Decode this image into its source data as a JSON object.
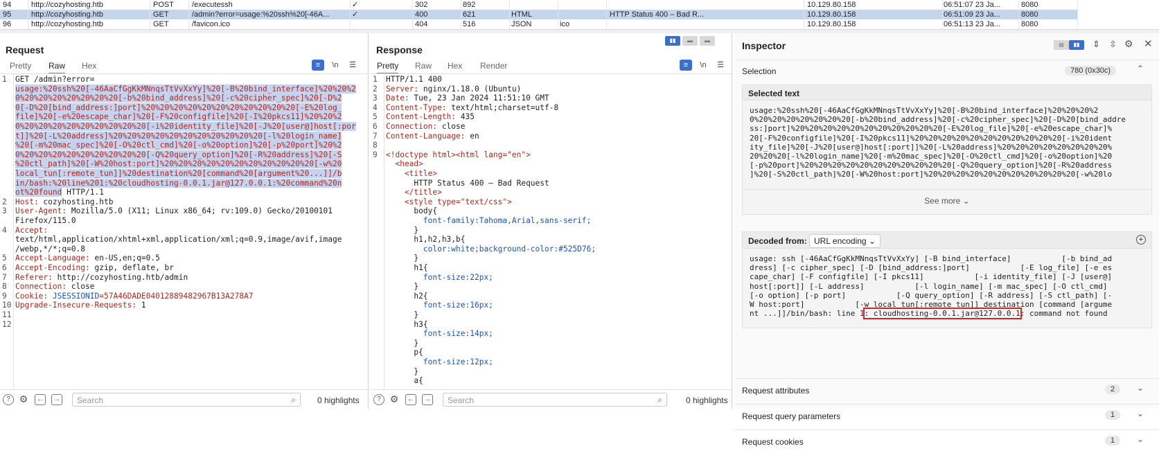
{
  "history": {
    "rows": [
      {
        "num": "94",
        "host": "http://cozyhosting.htb",
        "method": "POST",
        "url": "/executessh",
        "edited": "",
        "params": "✓",
        "status": "302",
        "length": "892",
        "mime": "",
        "ext": "",
        "title": "",
        "ip": "10.129.80.158",
        "time": "06:51:07 23 Ja...",
        "port": "8080"
      },
      {
        "num": "95",
        "host": "http://cozyhosting.htb",
        "method": "GET",
        "url": "/admin?error=usage:%20ssh%20[-46A...",
        "edited": "",
        "params": "✓",
        "status": "400",
        "length": "621",
        "mime": "HTML",
        "ext": "",
        "title": "HTTP Status 400 – Bad R...",
        "ip": "10.129.80.158",
        "time": "06:51:09 23 Ja...",
        "port": "8080"
      },
      {
        "num": "96",
        "host": "http://cozyhosting.htb",
        "method": "GET",
        "url": "/favicon.ico",
        "edited": "",
        "params": "",
        "status": "404",
        "length": "516",
        "mime": "JSON",
        "ext": "ico",
        "title": "",
        "ip": "10.129.80.158",
        "time": "06:51:13 23 Ja...",
        "port": "8080"
      }
    ]
  },
  "request": {
    "title": "Request",
    "tabs": [
      "Pretty",
      "Raw",
      "Hex"
    ],
    "active_tab": "Raw",
    "line1_prefix": "GET /admin?error=",
    "hl_lines": [
      "usage:%20ssh%20[-46AaCfGgKkMNnqsTtVvXxYy]%20[-B%20bind_interface]%20%20%2",
      "0%20%20%20%20%20%20%20[-b%20bind_address]%20[-c%20cipher_spec]%20[-D%2",
      "0[-D%20[bind_address:]port]%20%20%20%20%20%20%20%20%20%20%20[-E%20log_",
      "file]%20[-e%20escape_char]%20[-F%20configfile]%20[-I%20pkcs11]%20%20%2",
      "0%20%20%20%20%20%20%20%20%20[-i%20identity_file]%20[-J%20[user@]host[:por",
      "t]]%20[-L%20address]%20%20%20%20%20%20%20%20%20%20%20[-l%20login_name]",
      "%20[-m%20mac_spec]%20[-O%20ctl_cmd]%20[-o%20option]%20[-p%20port]%20%2",
      "0%20%20%20%20%20%20%20%20%20[-Q%20query_option]%20[-R%20address]%20[-S",
      "%20ctl_path]%20[-W%20host:port]%20%20%20%20%20%20%20%20%20%20%20[-w%20",
      "local_tun[:remote_tun]]%20destination%20[command%20[argument%20...]]/b",
      "in/bash:%20line%201:%20cloudhosting-0.0.1.jar@127.0.0.1:%20command%20n",
      "ot%20found"
    ],
    "line1_suffix": " HTTP/1.1",
    "headers": [
      {
        "n": "2",
        "k": "Host:",
        "v": " cozyhosting.htb"
      },
      {
        "n": "3",
        "k": "User-Agent:",
        "v": " Mozilla/5.0 (X11; Linux x86_64; rv:109.0) Gecko/20100101"
      },
      {
        "n": "",
        "k": "",
        "v": "Firefox/115.0"
      },
      {
        "n": "4",
        "k": "Accept:",
        "v": ""
      },
      {
        "n": "",
        "k": "",
        "v": "text/html,application/xhtml+xml,application/xml;q=0.9,image/avif,image"
      },
      {
        "n": "",
        "k": "",
        "v": "/webp,*/*;q=0.8"
      },
      {
        "n": "5",
        "k": "Accept-Language:",
        "v": " en-US,en;q=0.5"
      },
      {
        "n": "6",
        "k": "Accept-Encoding:",
        "v": " gzip, deflate, br"
      },
      {
        "n": "7",
        "k": "Referer:",
        "v": " http://cozyhosting.htb/admin"
      },
      {
        "n": "8",
        "k": "Connection:",
        "v": " close"
      },
      {
        "n": "9",
        "k": "Cookie:",
        "v": " ",
        "ck": "JSESSIONID",
        "cv": "=57A46DADE04012889482967B13A278A7"
      },
      {
        "n": "10",
        "k": "Upgrade-Insecure-Requests:",
        "v": " 1"
      },
      {
        "n": "11",
        "k": "",
        "v": ""
      },
      {
        "n": "12",
        "k": "",
        "v": ""
      }
    ],
    "search_placeholder": "Search",
    "highlights": "0 highlights"
  },
  "response": {
    "title": "Response",
    "tabs": [
      "Pretty",
      "Raw",
      "Hex",
      "Render"
    ],
    "active_tab": "Pretty",
    "lines": [
      {
        "n": "1",
        "t": "HTTP/1.1 400",
        "kind": "plain"
      },
      {
        "n": "2",
        "k": "Server:",
        "v": " nginx/1.18.0 (Ubuntu)",
        "kind": "hdr"
      },
      {
        "n": "3",
        "k": "Date:",
        "v": " Tue, 23 Jan 2024 11:51:10 GMT",
        "kind": "hdr"
      },
      {
        "n": "4",
        "k": "Content-Type:",
        "v": " text/html;charset=utf-8",
        "kind": "hdr"
      },
      {
        "n": "5",
        "k": "Content-Length:",
        "v": " 435",
        "kind": "hdr"
      },
      {
        "n": "6",
        "k": "Connection:",
        "v": " close",
        "kind": "hdr"
      },
      {
        "n": "7",
        "k": "Content-Language:",
        "v": " en",
        "kind": "hdr"
      },
      {
        "n": "8",
        "t": "",
        "kind": "plain"
      },
      {
        "n": "9",
        "t": "<!doctype html><html lang=\"en\">",
        "kind": "html"
      },
      {
        "n": "",
        "t": "  <head>",
        "kind": "html"
      },
      {
        "n": "",
        "t": "    <title>",
        "kind": "html"
      },
      {
        "n": "",
        "t": "      HTTP Status 400 – Bad Request",
        "kind": "plain"
      },
      {
        "n": "",
        "t": "    </title>",
        "kind": "html"
      },
      {
        "n": "",
        "t": "    <style type=\"text/css\">",
        "kind": "html"
      },
      {
        "n": "",
        "t": "      body{",
        "kind": "plain"
      },
      {
        "n": "",
        "t": "        font-family:Tahoma,Arial,sans-serif;",
        "kind": "css"
      },
      {
        "n": "",
        "t": "      }",
        "kind": "plain"
      },
      {
        "n": "",
        "t": "      h1,h2,h3,b{",
        "kind": "plain"
      },
      {
        "n": "",
        "t": "        color:white;background-color:#525D76;",
        "kind": "css"
      },
      {
        "n": "",
        "t": "      }",
        "kind": "plain"
      },
      {
        "n": "",
        "t": "      h1{",
        "kind": "plain"
      },
      {
        "n": "",
        "t": "        font-size:22px;",
        "kind": "css"
      },
      {
        "n": "",
        "t": "      }",
        "kind": "plain"
      },
      {
        "n": "",
        "t": "      h2{",
        "kind": "plain"
      },
      {
        "n": "",
        "t": "        font-size:16px;",
        "kind": "css"
      },
      {
        "n": "",
        "t": "      }",
        "kind": "plain"
      },
      {
        "n": "",
        "t": "      h3{",
        "kind": "plain"
      },
      {
        "n": "",
        "t": "        font-size:14px;",
        "kind": "css"
      },
      {
        "n": "",
        "t": "      }",
        "kind": "plain"
      },
      {
        "n": "",
        "t": "      p{",
        "kind": "plain"
      },
      {
        "n": "",
        "t": "        font-size:12px;",
        "kind": "css"
      },
      {
        "n": "",
        "t": "      }",
        "kind": "plain"
      },
      {
        "n": "",
        "t": "      a{",
        "kind": "plain"
      }
    ],
    "search_placeholder": "Search",
    "highlights": "0 highlights"
  },
  "inspector": {
    "title": "Inspector",
    "selection_label": "Selection",
    "selection_size": "780 (0x30c)",
    "selected_text_label": "Selected text",
    "selected_text_lines": [
      "usage:%20ssh%20[-46AaCfGgKkMNnqsTtVvXxYy]%20[-B%20bind_interface]%20%20%20%2",
      "0%20%20%20%20%20%20%20[-b%20bind_address]%20[-c%20cipher_spec]%20[-D%20[bind_addre",
      "ss:]port]%20%20%20%20%20%20%20%20%20%20%20[-E%20log_file]%20[-e%20escape_char]%",
      "20[-F%20configfile]%20[-I%20pkcs11]%20%20%20%20%20%20%20%20%20%20%20[-i%20ident",
      "ity_file]%20[-J%20[user@]host[:port]]%20[-L%20address]%20%20%20%20%20%20%20%20%",
      "20%20%20[-l%20login_name]%20[-m%20mac_spec]%20[-O%20ctl_cmd]%20[-o%20option]%20",
      "[-p%20port]%20%20%20%20%20%20%20%20%20%20%20[-Q%20query_option]%20[-R%20address",
      "]%20[-S%20ctl_path]%20[-W%20host:port]%20%20%20%20%20%20%20%20%20%20%20[-w%20lo"
    ],
    "see_more": "See more",
    "decoded_label": "Decoded from:",
    "decoded_encoding": "URL encoding",
    "decoded_lines": [
      "usage: ssh [-46AaCfGgKkMNnqsTtVvXxYy] [-B bind_interface]           [-b bind_ad",
      "dress] [-c cipher_spec] [-D [bind_address:]port]           [-E log_file] [-e es",
      "cape_char] [-F configfile] [-I pkcs11]           [-i identity_file] [-J [user@]",
      "host[:port]] [-L address]           [-l login_name] [-m mac_spec] [-O ctl_cmd]",
      "[-o option] [-p port]           [-Q query_option] [-R address] [-S ctl_path] [-",
      "W host:port]           [-w local_tun[:remote_tun]] destination [command [argume",
      "nt ...]]/bin/bash: line 1"
    ],
    "decoded_boxed": ": cloudhosting-0.0.1.jar@127.0.0.1",
    "decoded_tail": ": command not found",
    "sections": [
      {
        "label": "Request attributes",
        "count": "2"
      },
      {
        "label": "Request query parameters",
        "count": "1"
      },
      {
        "label": "Request cookies",
        "count": "1"
      }
    ]
  }
}
